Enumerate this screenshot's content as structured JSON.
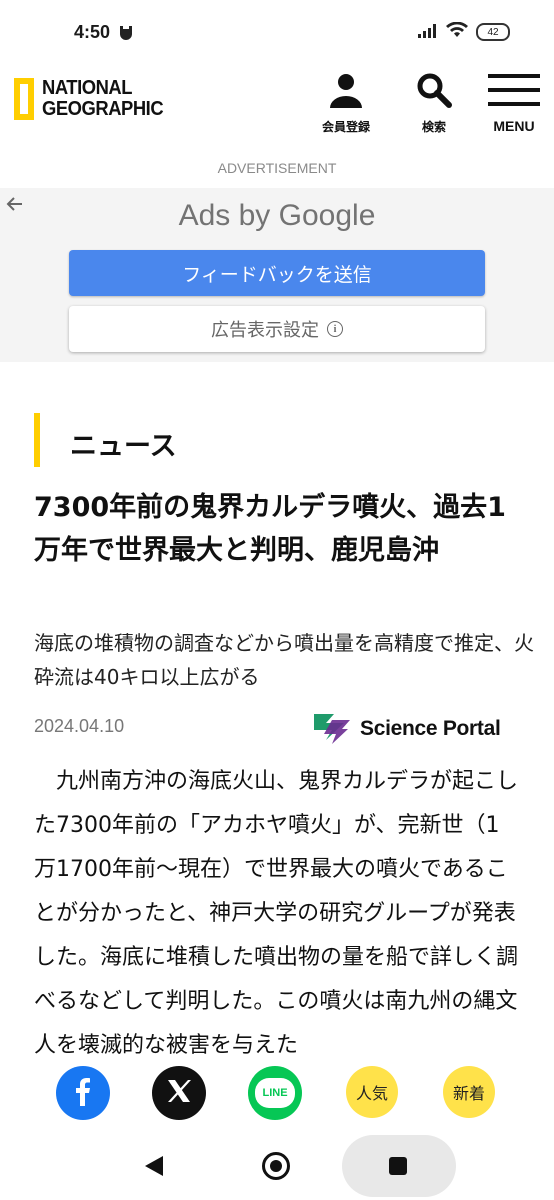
{
  "status_bar": {
    "time": "4:50",
    "battery": "42"
  },
  "header": {
    "logo_line1": "NATIONAL",
    "logo_line2": "GEOGRAPHIC",
    "member_label": "会員登録",
    "search_label": "検索",
    "menu_label": "MENU"
  },
  "ad": {
    "label": "ADVERTISEMENT",
    "ads_by_prefix": "Ads by",
    "ads_by_brand": "Google",
    "feedback_button": "フィードバックを送信",
    "settings_button": "広告表示設定",
    "info_symbol": "i"
  },
  "article": {
    "section": "ニュース",
    "title": "7300年前の鬼界カルデラ噴火、過去1万年で世界最大と判明、鹿児島沖",
    "subtitle": "海底の堆積物の調査などから噴出量を高精度で推定、火砕流は40キロ以上広がる",
    "date": "2024.04.10",
    "source": "Science Portal",
    "body": "九州南方沖の海底火山、鬼界カルデラが起こした7300年前の「アカホヤ噴火」が、完新世（1万1700年前〜現在）で世界最大の噴火であることが分かったと、神戸大学の研究グループが発表した。海底に堆積した噴出物の量を船で詳しく調べるなどして判明した。この噴火は南九州の縄文人を壊滅的な被害を与えた"
  },
  "share": {
    "popular_label": "人気",
    "new_label": "新着",
    "line_label": "LINE"
  },
  "colors": {
    "brand_yellow": "#ffce00",
    "ad_button_blue": "#4a87ed",
    "facebook": "#1877f2",
    "line": "#06c755"
  }
}
